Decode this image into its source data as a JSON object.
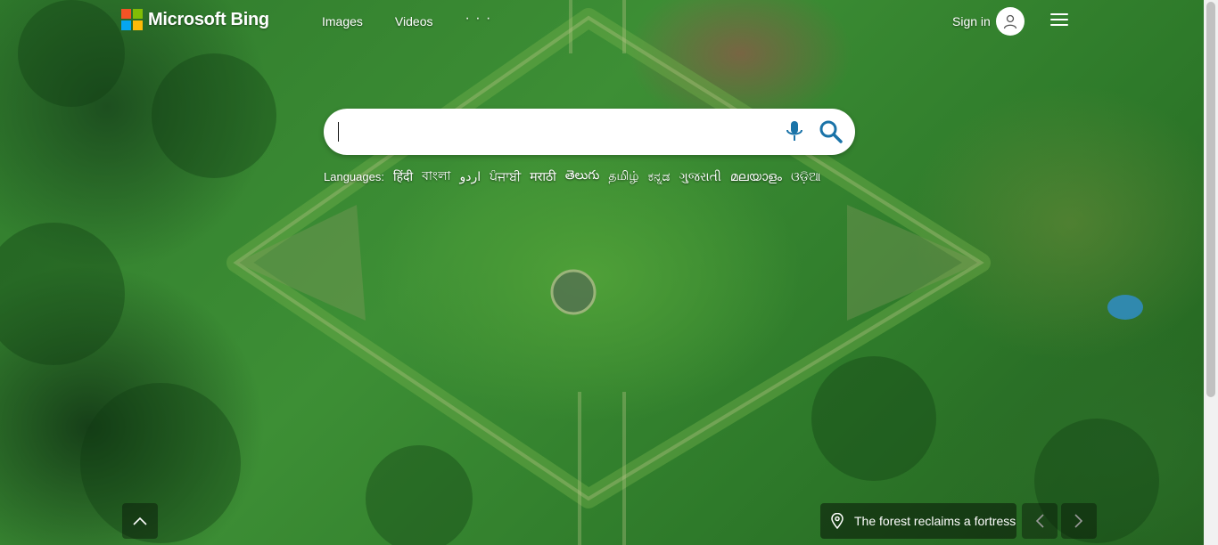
{
  "brand": {
    "name": "Microsoft Bing",
    "logo_colors": [
      "#f35325",
      "#81bc06",
      "#05a6f0",
      "#ffba08"
    ]
  },
  "nav": {
    "items": [
      "Images",
      "Videos"
    ],
    "more": "· · ·"
  },
  "header": {
    "signin_label": "Sign in",
    "avatar_icon": "user-icon",
    "menu_icon": "hamburger-icon"
  },
  "search": {
    "value": "",
    "placeholder": "",
    "mic_icon": "microphone-icon",
    "search_icon": "search-icon",
    "accent": "#1a73a8"
  },
  "languages": {
    "label": "Languages:",
    "items": [
      "हिंदी",
      "বাংলা",
      "اردو",
      "ਪੰਜਾਬੀ",
      "मराठी",
      "తెలుగు",
      "தமிழ்",
      "ಕನ್ನಡ",
      "ગુજરાતી",
      "മലയാളം",
      "ଓଡ଼ିଆ"
    ]
  },
  "footer": {
    "scroll_up_icon": "chevron-up-icon",
    "caption": "The forest reclaims a fortress",
    "location_icon": "location-pin-icon",
    "prev_icon": "chevron-left-icon",
    "next_icon": "chevron-right-icon"
  }
}
